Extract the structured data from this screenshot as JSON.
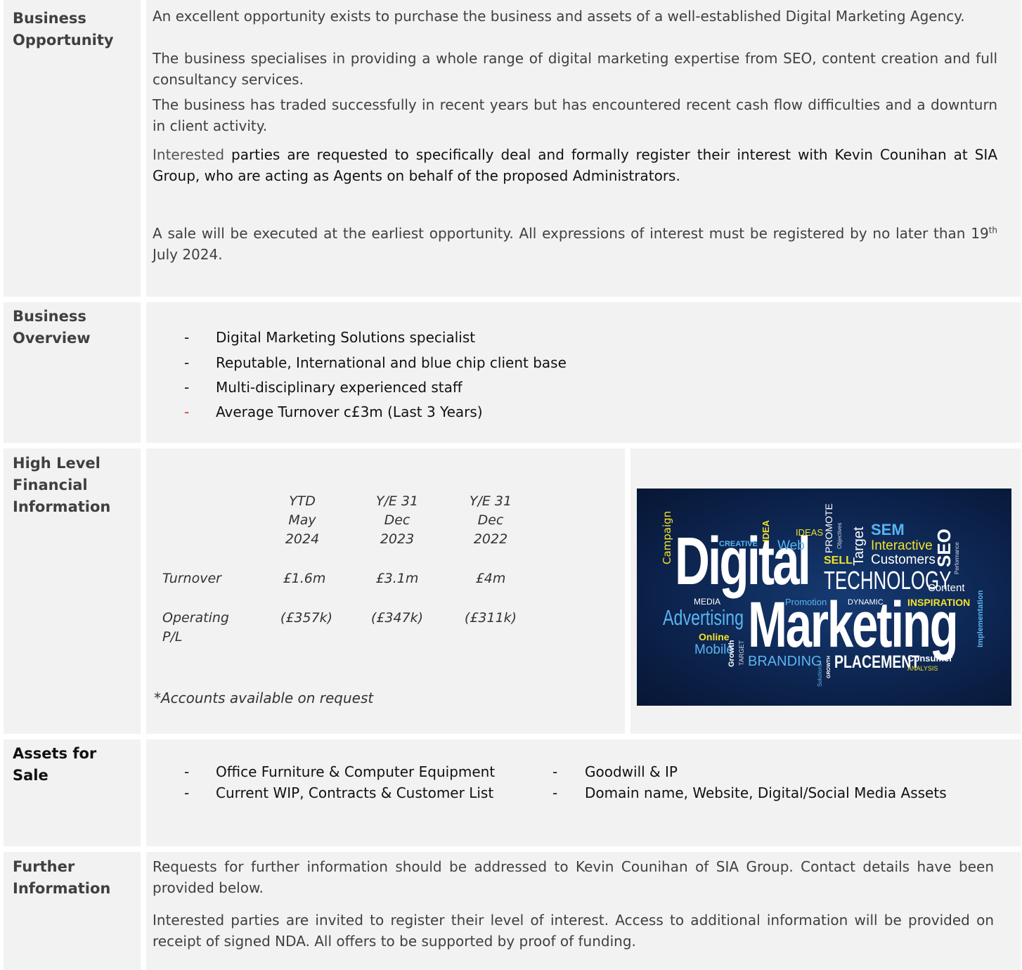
{
  "rows": {
    "opportunity": {
      "label_lines": [
        "Business",
        "Opportunity"
      ],
      "paragraphs": [
        "An excellent opportunity exists to purchase the business and assets of a well-established Digital Marketing Agency.",
        "The business specialises in providing a whole range of digital marketing expertise from SEO, content creation and full consultancy services.",
        "The business has traded successfully in recent years but has encountered recent cash flow difficulties and a downturn in client activity."
      ],
      "interest_lead": "Interested",
      "interest_rest": " parties are requested to specifically deal and formally register their interest with Kevin Counihan at SIA Group, who are acting as Agents on behalf of the proposed Administrators.",
      "sale_text": "A sale will be executed at the earliest opportunity. All expressions of interest must be registered by no later than 19",
      "sale_sup": "th",
      "sale_tail": " July 2024."
    },
    "overview": {
      "label_lines": [
        "Business",
        "Overview"
      ],
      "bullets": [
        "Digital Marketing Solutions specialist",
        "Reputable, International and blue chip client base",
        "Multi-disciplinary experienced staff",
        "Average Turnover c£3m (Last 3 Years)"
      ],
      "dash": "-"
    },
    "financial": {
      "label_lines": [
        "High Level",
        "Financial",
        "Information"
      ],
      "columns": [
        [
          "YTD",
          "May",
          "2024"
        ],
        [
          "Y/E 31",
          "Dec",
          "2023"
        ],
        [
          "Y/E 31",
          "Dec",
          "2022"
        ]
      ],
      "rows": [
        {
          "label_lines": [
            "Turnover"
          ],
          "values": [
            "£1.6m",
            "£3.1m",
            "£4m"
          ]
        },
        {
          "label_lines": [
            "Operating",
            "P/L"
          ],
          "values": [
            "(£357k)",
            "(£347k)",
            "(£311k)"
          ]
        }
      ],
      "note": "*Accounts available on request"
    },
    "assets": {
      "label_lines": [
        "Assets for",
        "Sale"
      ],
      "left": [
        "Office Furniture & Computer Equipment",
        "Current WIP, Contracts & Customer List"
      ],
      "right": [
        "Goodwill & IP",
        "Domain name, Website, Digital/Social Media Assets"
      ]
    },
    "further": {
      "label_lines": [
        "Further",
        "Information"
      ],
      "paragraphs": [
        "Requests for further information should be addressed to Kevin Counihan of SIA Group. Contact details have been provided below.",
        "Interested parties are invited to register their level of interest. Access to additional information will be provided on receipt of signed NDA. All offers to be supported by proof of funding."
      ]
    }
  },
  "word_cloud": {
    "colors": {
      "white": "#ffffff",
      "yellow": "#f2e12b",
      "blue": "#5ab4f0",
      "bg": "#0d2550"
    },
    "words": {
      "digital": "Digital",
      "technology": "TECHNOLOGY",
      "marketing": "Marketing",
      "advertising": "Advertising",
      "sem": "SEM",
      "interactive": "Interactive",
      "customers": "Customers",
      "seo": "SEO",
      "content": "Content",
      "campaign": "Campaign",
      "creative": "CREATIVE",
      "web": "Web",
      "idea": "IDEA",
      "ideas": "IDEAS",
      "promote": "PROMOTE",
      "objectives": "Objectives",
      "target": "Target",
      "sell": "SELL",
      "media": "MEDIA",
      "promotion": "Promotion",
      "dynamic": "DYNAMIC",
      "inspiration": "INSPIRATION",
      "online": "Online",
      "mobile": "Mobile",
      "growth": "Growth",
      "target_small": "TARGET",
      "branding": "BRANDING",
      "placement": "PLACEMENT",
      "consumer": "Consumer",
      "analysis": "ANALYSIS",
      "implementation": "Implementation",
      "performance": "Performance",
      "solutions": "Solutions",
      "growth_caps": "GROWTH"
    }
  }
}
